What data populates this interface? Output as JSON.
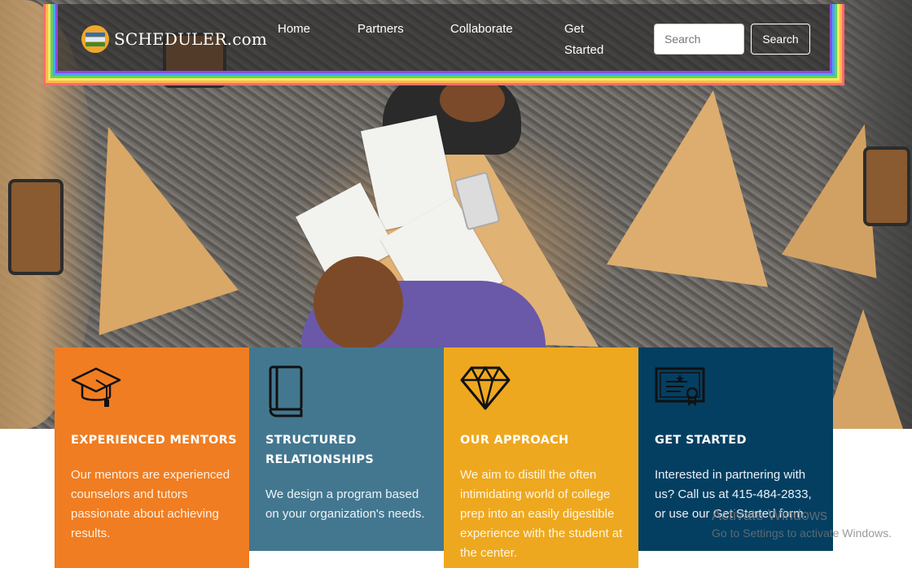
{
  "brand": {
    "name": "SCHEDULER.com",
    "logo_icon": "books-stack-icon"
  },
  "nav": {
    "links": [
      "Home",
      "Partners",
      "Collaborate",
      "Get Started"
    ]
  },
  "search": {
    "placeholder": "Search",
    "button_label": "Search"
  },
  "features": [
    {
      "icon": "graduation-cap-icon",
      "title": "EXPERIENCED MENTORS",
      "description": "Our mentors are experienced counselors and tutors passionate about achieving results.",
      "color": "#f07d21"
    },
    {
      "icon": "book-icon",
      "title": "STRUCTURED RELATIONSHIPS",
      "description": "We design a program based on your organization's needs.",
      "color": "#437790"
    },
    {
      "icon": "diamond-icon",
      "title": "OUR APPROACH",
      "description": "We aim to distill the often intimidating world of college prep into an easily digestible experience with the student at the center.",
      "color": "#eea81f"
    },
    {
      "icon": "certificate-icon",
      "title": "GET STARTED",
      "description": "Interested in partnering with us? Call us at 415-484-2833, or use our Get Started form.",
      "color": "#043f62"
    }
  ],
  "watermark": {
    "title": "Activate Windows",
    "subtitle": "Go to Settings to activate Windows."
  }
}
